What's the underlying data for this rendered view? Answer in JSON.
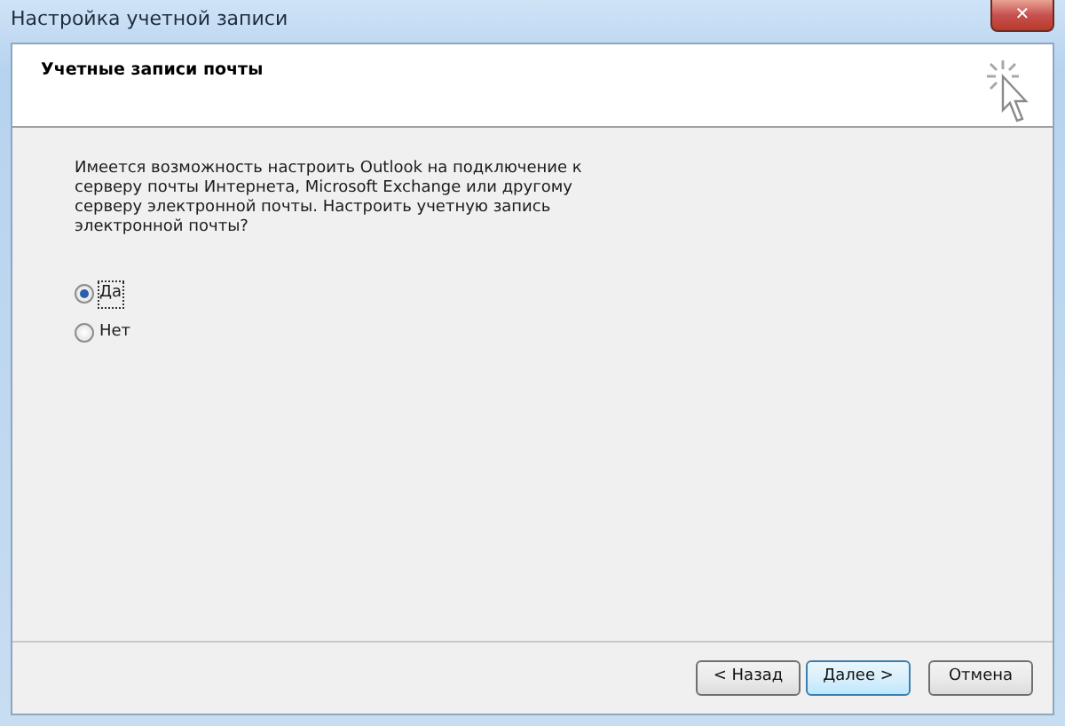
{
  "window": {
    "title": "Настройка учетной записи",
    "close": "✕"
  },
  "header": {
    "title": "Учетные записи почты"
  },
  "description": "Имеется возможность настроить Outlook на подключение к серверу почты Интернета, Microsoft Exchange или другому серверу электронной почты. Настроить учетную запись электронной почты?",
  "options": [
    {
      "label": "Да",
      "selected": true
    },
    {
      "label": "Нет",
      "selected": false
    }
  ],
  "buttons": [
    {
      "label": "< Назад",
      "default": false
    },
    {
      "label": "Далее >",
      "default": true
    },
    {
      "label": "Отмена",
      "default": false
    }
  ]
}
